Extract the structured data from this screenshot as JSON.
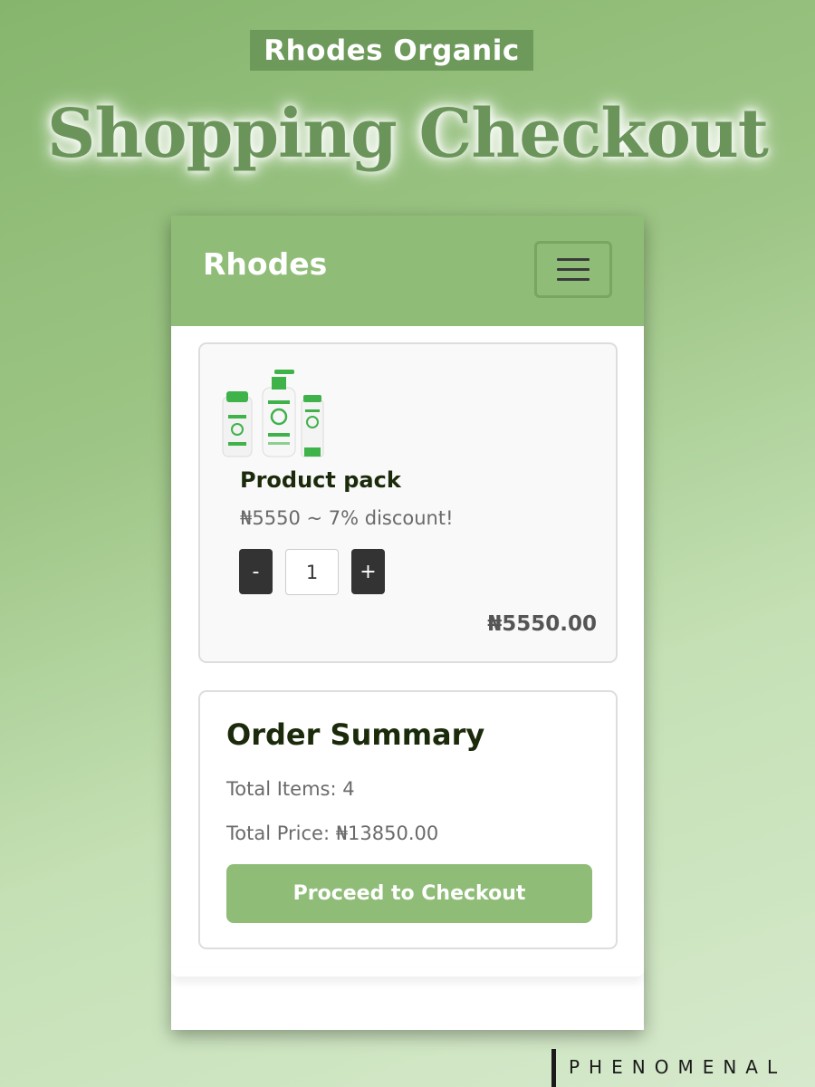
{
  "header": {
    "badge": "Rhodes Organic",
    "headline": "Shopping Checkout"
  },
  "navbar": {
    "brand": "Rhodes",
    "menu_icon": "hamburger-menu-icon"
  },
  "product": {
    "image_icon": "product-bottles-image",
    "name": "Product pack",
    "description": "₦5550 ~ 7% discount!",
    "minus_label": "-",
    "plus_label": "+",
    "quantity": "1",
    "total": "₦5550.00"
  },
  "summary": {
    "title": "Order Summary",
    "total_items": "Total Items: 4",
    "total_price": "Total Price: ₦13850.00",
    "checkout_label": "Proceed to Checkout"
  },
  "footer": {
    "brand": "PHENOMENAL"
  },
  "colors": {
    "accent": "#8fbd77",
    "badge": "#6d9a5a",
    "headline": "#6b945b",
    "dark_button": "#333333"
  }
}
